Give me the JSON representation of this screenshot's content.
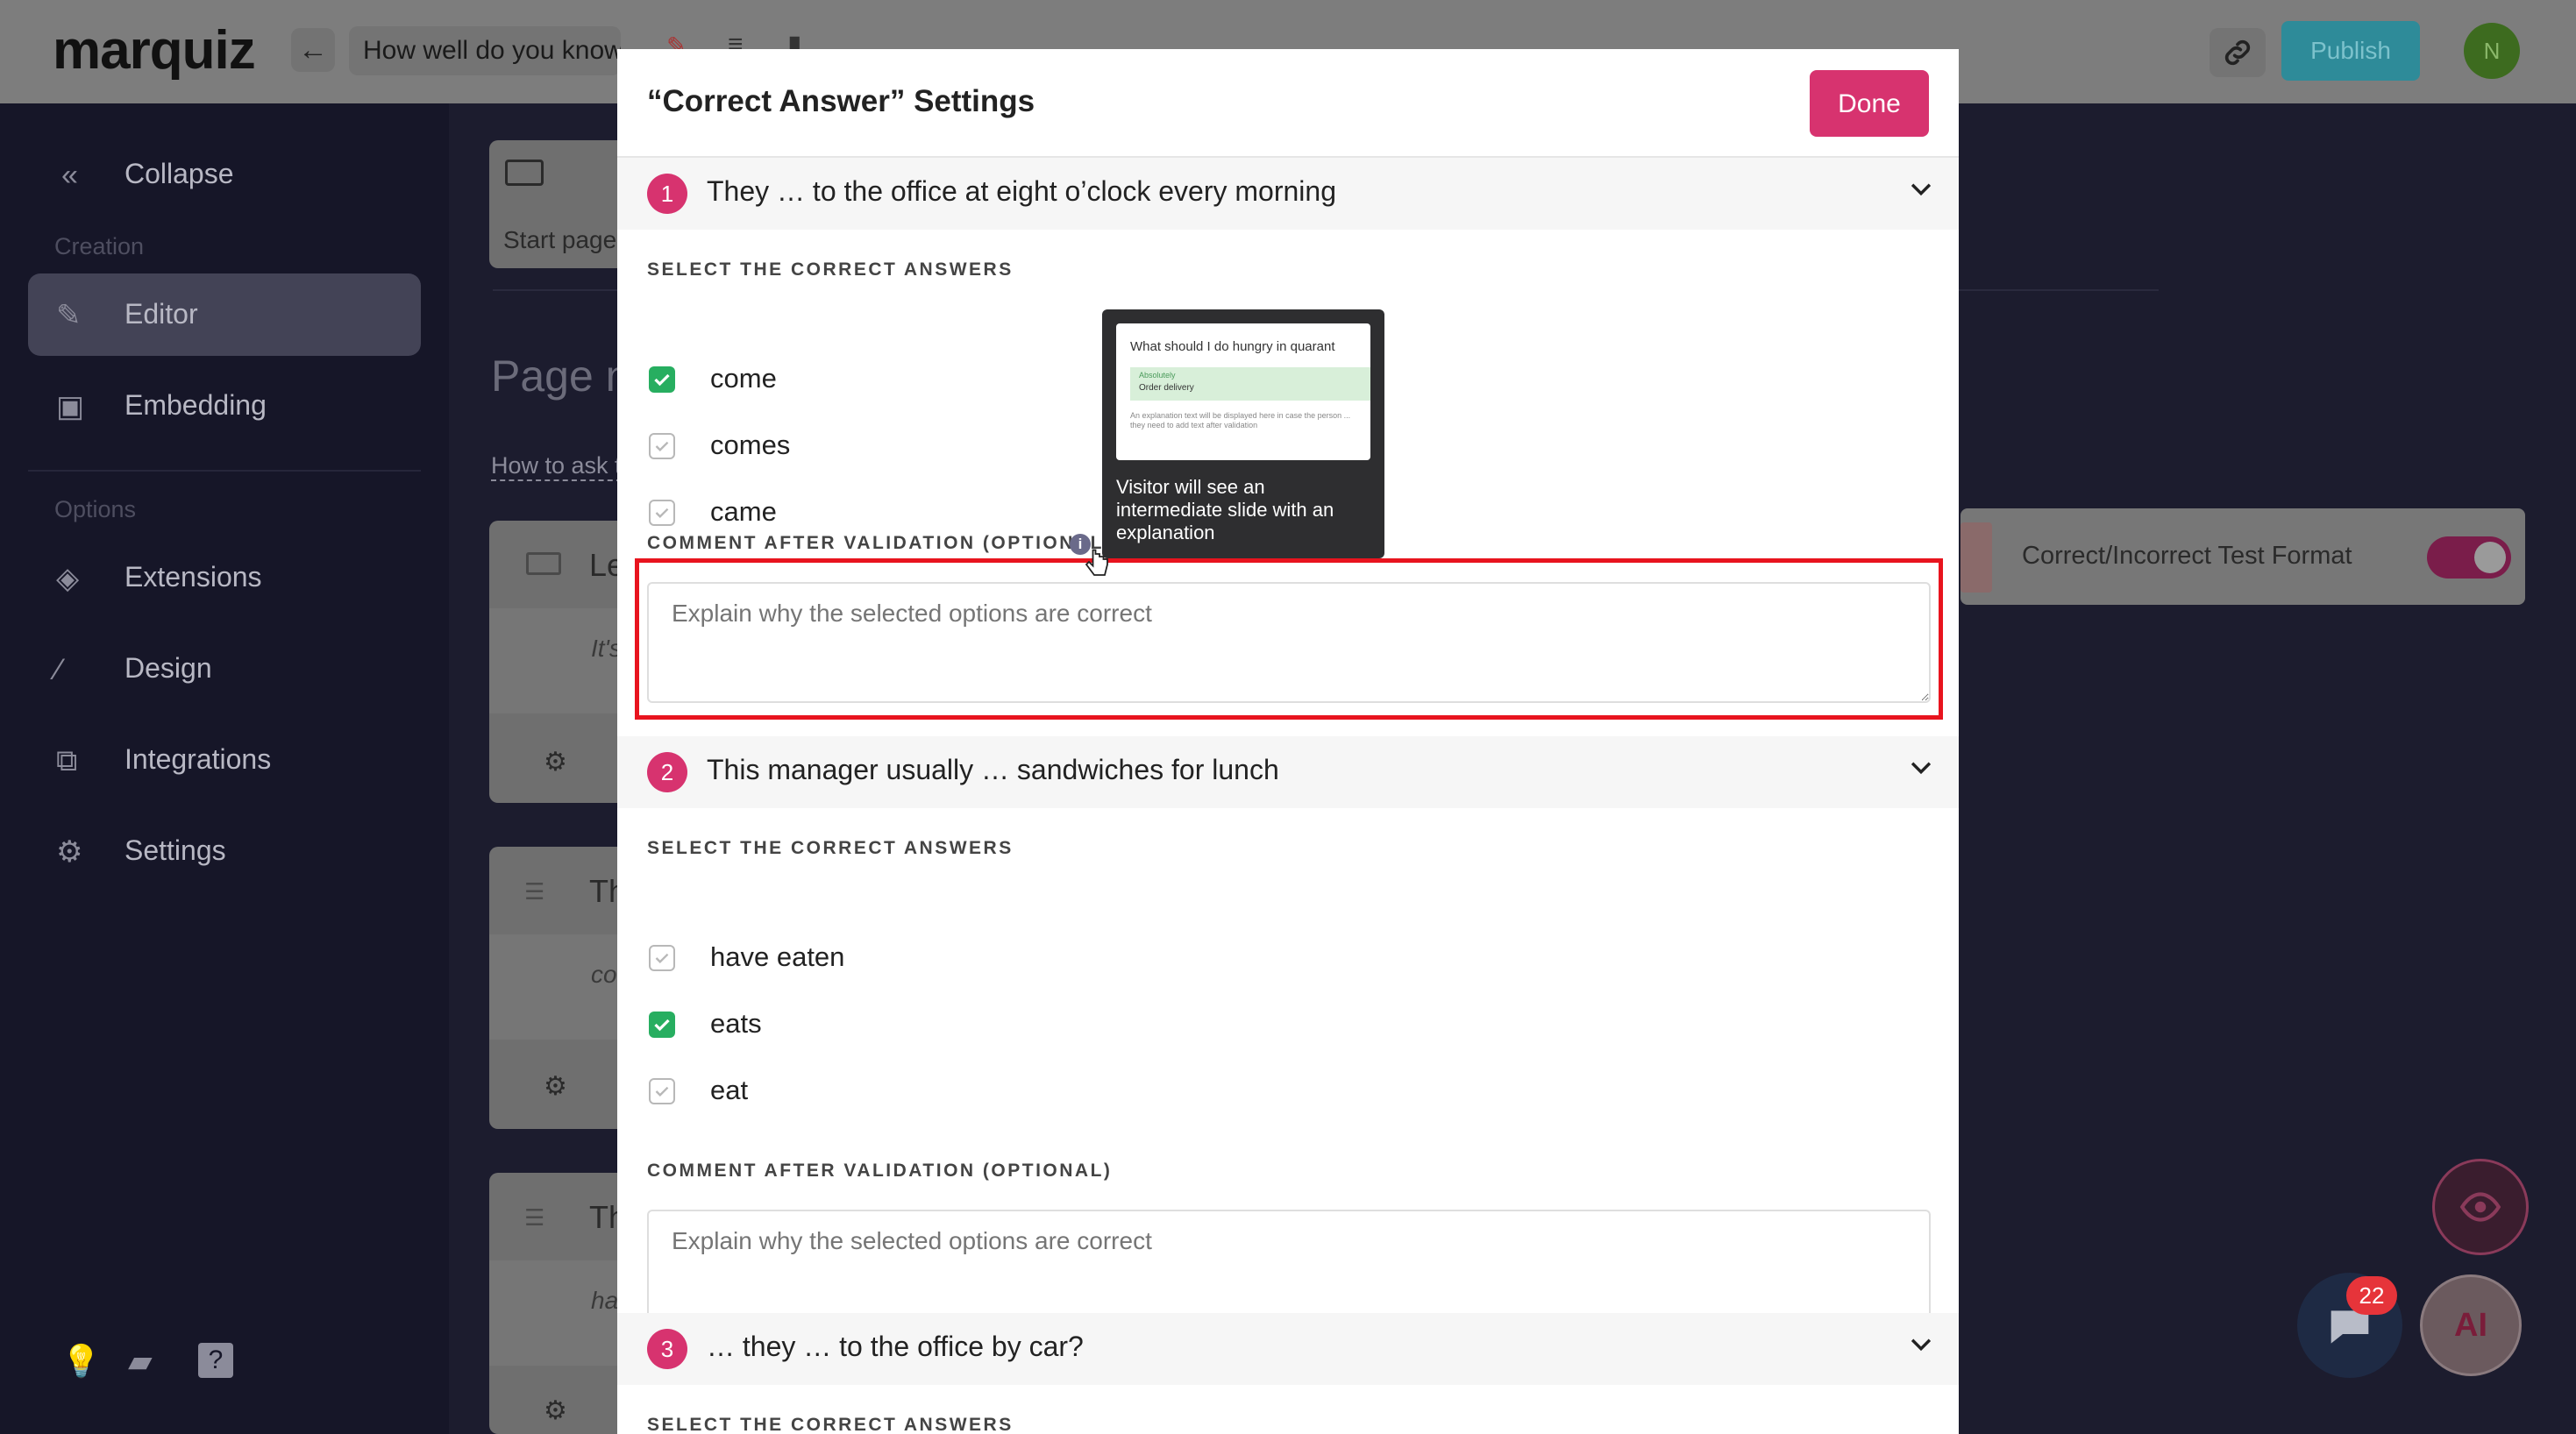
{
  "topbar": {
    "logo": "marquiz",
    "quiz_name": "How well do you know",
    "publish_label": "Publish",
    "avatar_initial": "N"
  },
  "sidebar": {
    "collapse_label": "Collapse",
    "section_creation": "Creation",
    "section_options": "Options",
    "items": [
      {
        "label": "Editor"
      },
      {
        "label": "Embedding"
      },
      {
        "label": "Extensions"
      },
      {
        "label": "Design"
      },
      {
        "label": "Integrations"
      },
      {
        "label": "Settings"
      }
    ]
  },
  "background": {
    "start_page_label": "Start page",
    "page_title_partial": "Page n",
    "how_to_ask_partial": "How to ask t",
    "card1_title_partial": "Le",
    "card1_sub_partial": "It's",
    "card2_title_partial": "Th",
    "card2_sub_partial": "co",
    "card3_title_partial": "Th",
    "card3_sub_partial": "ha",
    "right_panel_label": "Correct/Incorrect Test Format"
  },
  "fabs": {
    "chat_badge": "22",
    "ai_label": "AI"
  },
  "modal": {
    "title": "“Correct Answer” Settings",
    "done_label": "Done",
    "select_label": "SELECT THE CORRECT ANSWERS",
    "comment_label": "COMMENT AFTER VALIDATION (OPTIONAL)",
    "comment_placeholder": "Explain why the selected options are correct",
    "questions": [
      {
        "number": "1",
        "text": "They … to the office at eight o’clock every morning",
        "options": [
          {
            "label": "come",
            "checked": true
          },
          {
            "label": "comes",
            "checked": false
          },
          {
            "label": "came",
            "checked": false
          }
        ]
      },
      {
        "number": "2",
        "text": "This manager usually … sandwiches for lunch",
        "options": [
          {
            "label": "have eaten",
            "checked": false
          },
          {
            "label": "eats",
            "checked": true
          },
          {
            "label": "eat",
            "checked": false
          }
        ]
      },
      {
        "number": "3",
        "text": "… they … to the office by car?"
      }
    ]
  },
  "tooltip": {
    "preview_title": "What should I do hungry in quarant",
    "preview_option_small": "Absolutely",
    "preview_option": "Order delivery",
    "preview_note": "An explanation text will be displayed here in case the person ... they need to add text after validation",
    "text": "Visitor will see an intermediate slide with an explanation"
  },
  "colors": {
    "accent": "#d7336f",
    "checked": "#27ae60",
    "highlight": "#e8141e"
  }
}
